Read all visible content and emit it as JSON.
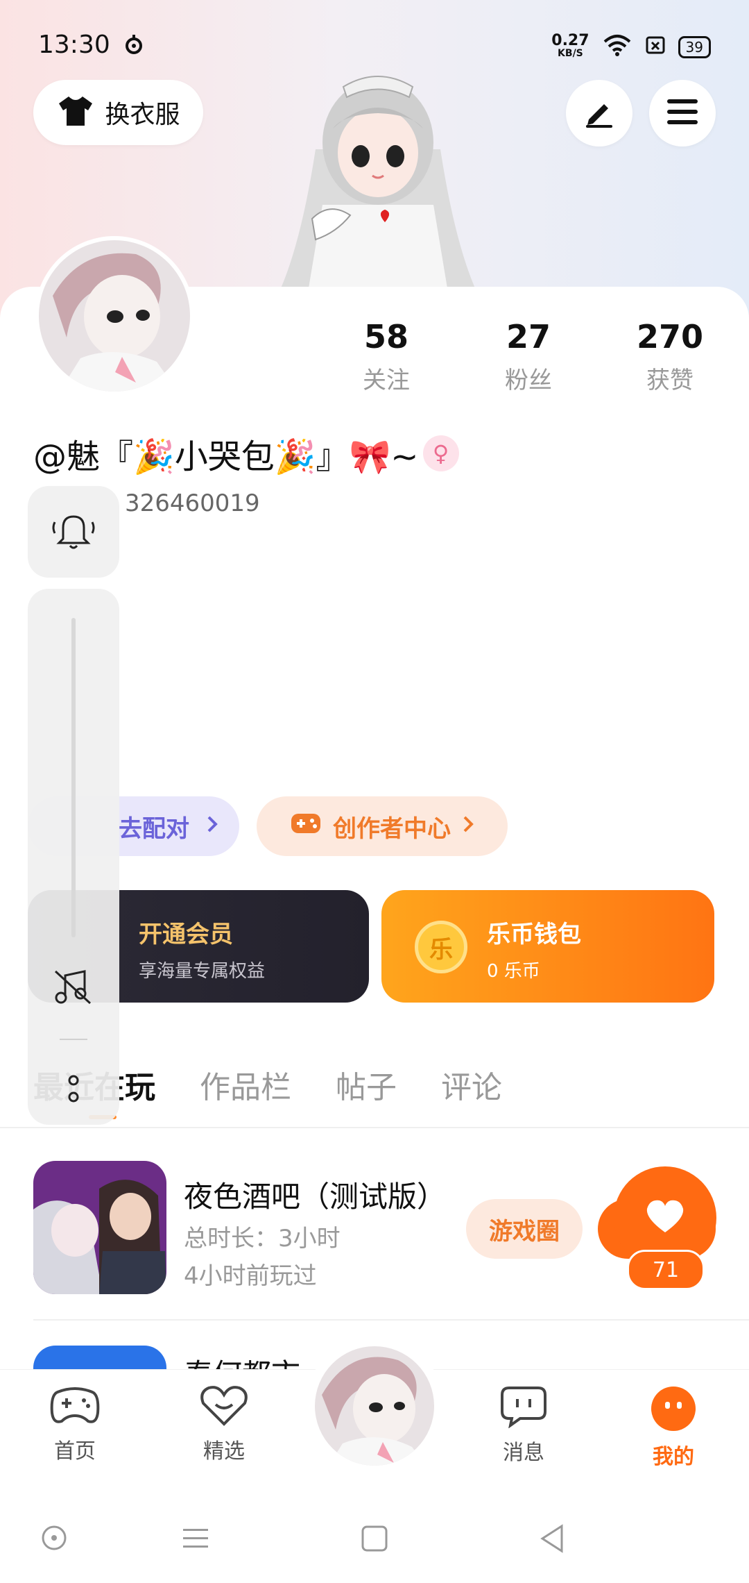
{
  "status_bar": {
    "time": "13:30",
    "net_speed_value": "0.27",
    "net_speed_unit": "KB/S",
    "battery": "39"
  },
  "header": {
    "dress_up_label": "换衣服"
  },
  "profile": {
    "stats": [
      {
        "value": "58",
        "label": "关注"
      },
      {
        "value": "27",
        "label": "粉丝"
      },
      {
        "value": "270",
        "label": "获赞"
      }
    ],
    "name": "@魅『🎉小哭包🎉』🎀~",
    "id_number": "326460019",
    "gender_symbol": "♀"
  },
  "actions": {
    "pair_label": "去配对",
    "creator_label": "创作者中心"
  },
  "cards": {
    "vip_title": "开通会员",
    "vip_sub": "享海量专属权益",
    "coin_title": "乐币钱包",
    "coin_sub": "0 乐币",
    "coin_glyph": "乐"
  },
  "tabs": [
    {
      "label": "最近在玩",
      "active": true
    },
    {
      "label": "作品栏"
    },
    {
      "label": "帖子"
    },
    {
      "label": "评论"
    }
  ],
  "games": [
    {
      "title": "夜色酒吧（测试版）",
      "duration": "总时长：3小时",
      "last_played": "4小时前玩过",
      "circle_label": "游戏圈"
    },
    {
      "title": "泰何都市"
    }
  ],
  "like_widget": {
    "count": "71"
  },
  "bottom_nav": [
    {
      "label": "首页",
      "icon": "gamepad-icon"
    },
    {
      "label": "精选",
      "icon": "heart-icon"
    },
    {
      "label": "消息",
      "icon": "message-icon"
    },
    {
      "label": "我的",
      "icon": "profile-face-icon",
      "active": true
    }
  ],
  "colors": {
    "accent": "#ff6a12",
    "creator_bg": "#fde9de",
    "pair_bg": "#e9e7fb",
    "vip_text": "#f5c36b"
  }
}
